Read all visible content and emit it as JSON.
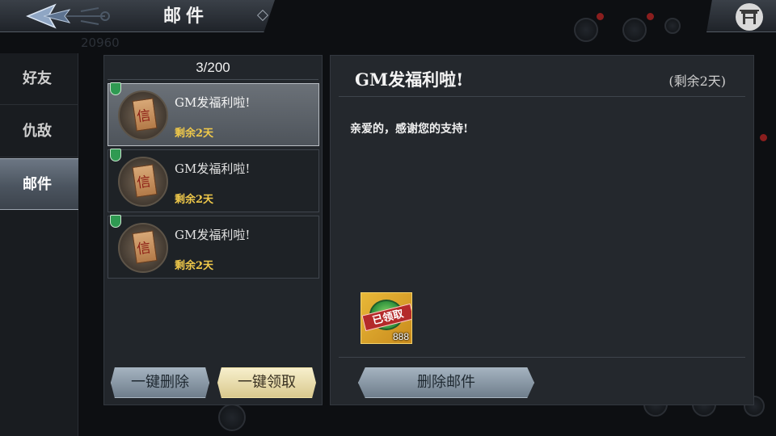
{
  "header": {
    "title": "邮件"
  },
  "background": {
    "score": "20960"
  },
  "sidebar": {
    "tabs": [
      {
        "label": "好友",
        "active": false
      },
      {
        "label": "仇敌",
        "active": false
      },
      {
        "label": "邮件",
        "active": true
      }
    ]
  },
  "mail_list": {
    "count": "3/200",
    "items": [
      {
        "icon_char": "信",
        "title": "GM发福利啦!",
        "expire": "剩余2天",
        "selected": true
      },
      {
        "icon_char": "信",
        "title": "GM发福利啦!",
        "expire": "剩余2天",
        "selected": false
      },
      {
        "icon_char": "信",
        "title": "GM发福利啦!",
        "expire": "剩余2天",
        "selected": false
      }
    ],
    "delete_all_label": "一键删除",
    "claim_all_label": "一键领取"
  },
  "mail_detail": {
    "title": "GM发福利啦!",
    "remaining": "(剩余2天)",
    "body": "亲爱的，感谢您的支持!",
    "reward": {
      "stamp": "已领取",
      "quantity": "888",
      "icon": "jade-coin-icon"
    },
    "delete_label": "删除邮件"
  },
  "colors": {
    "accent_gold": "#f0c94a",
    "flag_green": "#2f9a52",
    "claimed_red": "#b42a2a"
  }
}
